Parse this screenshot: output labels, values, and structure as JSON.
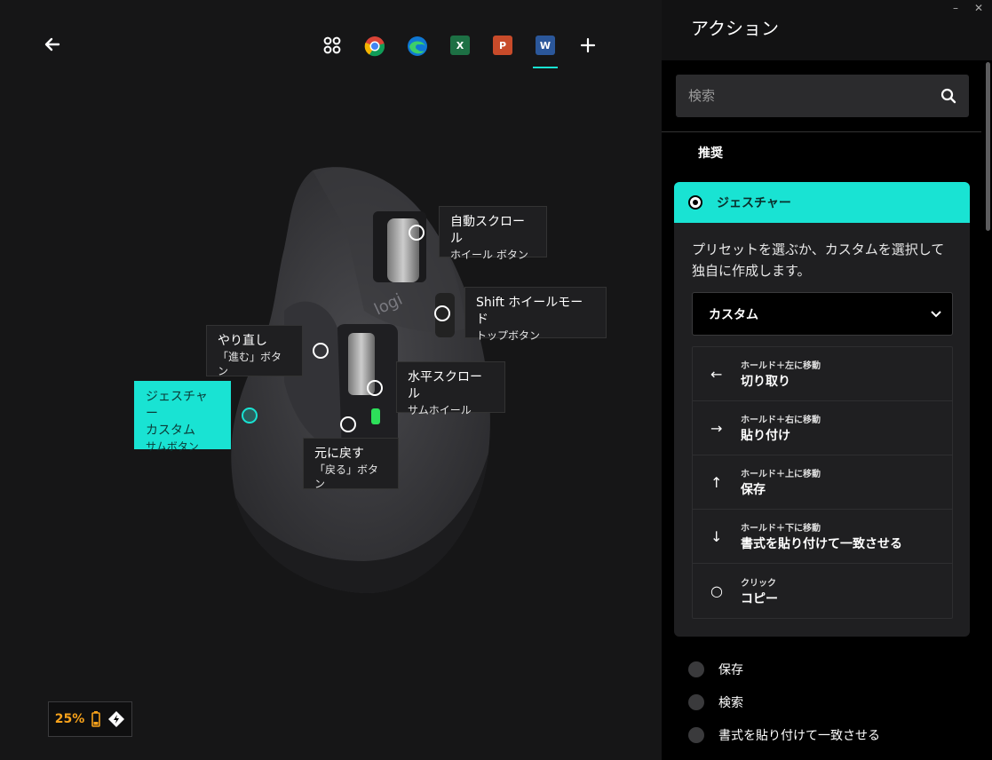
{
  "tabs": [
    {
      "name": "all-apps",
      "label": "",
      "color": "#ffffff"
    },
    {
      "name": "chrome",
      "label": "",
      "color": "#4285f4"
    },
    {
      "name": "edge",
      "label": "",
      "color": "#1e88e5"
    },
    {
      "name": "excel",
      "label": "X",
      "color": "#1d7044"
    },
    {
      "name": "powerpoint",
      "label": "P",
      "color": "#c84b2a"
    },
    {
      "name": "word",
      "label": "W",
      "color": "#2b579a"
    }
  ],
  "callouts": {
    "auto_scroll": {
      "t1": "自動スクロール",
      "t2": "ホイール ボタン"
    },
    "shift_wheel": {
      "t1": "Shift ホイールモード",
      "t2": "トップボタン"
    },
    "redo": {
      "t1": "やり直し",
      "t2": "「進む」ボタン"
    },
    "hscroll": {
      "t1": "水平スクロール",
      "t2": "サムホイール"
    },
    "gesture": {
      "t1a": "ジェスチャー",
      "t1b": "カスタム",
      "t2": "サムボタン"
    },
    "undo": {
      "t1": "元に戻す",
      "t2": "「戻る」ボタン"
    }
  },
  "mouse_logo": "logi",
  "battery": {
    "percent": "25%",
    "color": "#f7a21b"
  },
  "right": {
    "title": "アクション",
    "window_controls": {
      "minimize": "–",
      "close": "✕"
    },
    "search_placeholder": "検索",
    "section": "推奨",
    "panel": {
      "head": "ジェスチャー",
      "description": "プリセットを選ぶか、カスタムを選択して独自に作成します。",
      "dropdown_value": "カスタム",
      "gestures": [
        {
          "icon": "←",
          "small": "ホールド＋左に移動",
          "big": "切り取り"
        },
        {
          "icon": "→",
          "small": "ホールド＋右に移動",
          "big": "貼り付け"
        },
        {
          "icon": "↑",
          "small": "ホールド＋上に移動",
          "big": "保存"
        },
        {
          "icon": "↓",
          "small": "ホールド＋下に移動",
          "big": "書式を貼り付けて一致させる"
        },
        {
          "icon": "○",
          "small": "クリック",
          "big": "コピー"
        }
      ]
    },
    "other_actions": [
      "保存",
      "検索",
      "書式を貼り付けて一致させる"
    ]
  },
  "accent": "#19e3d3"
}
